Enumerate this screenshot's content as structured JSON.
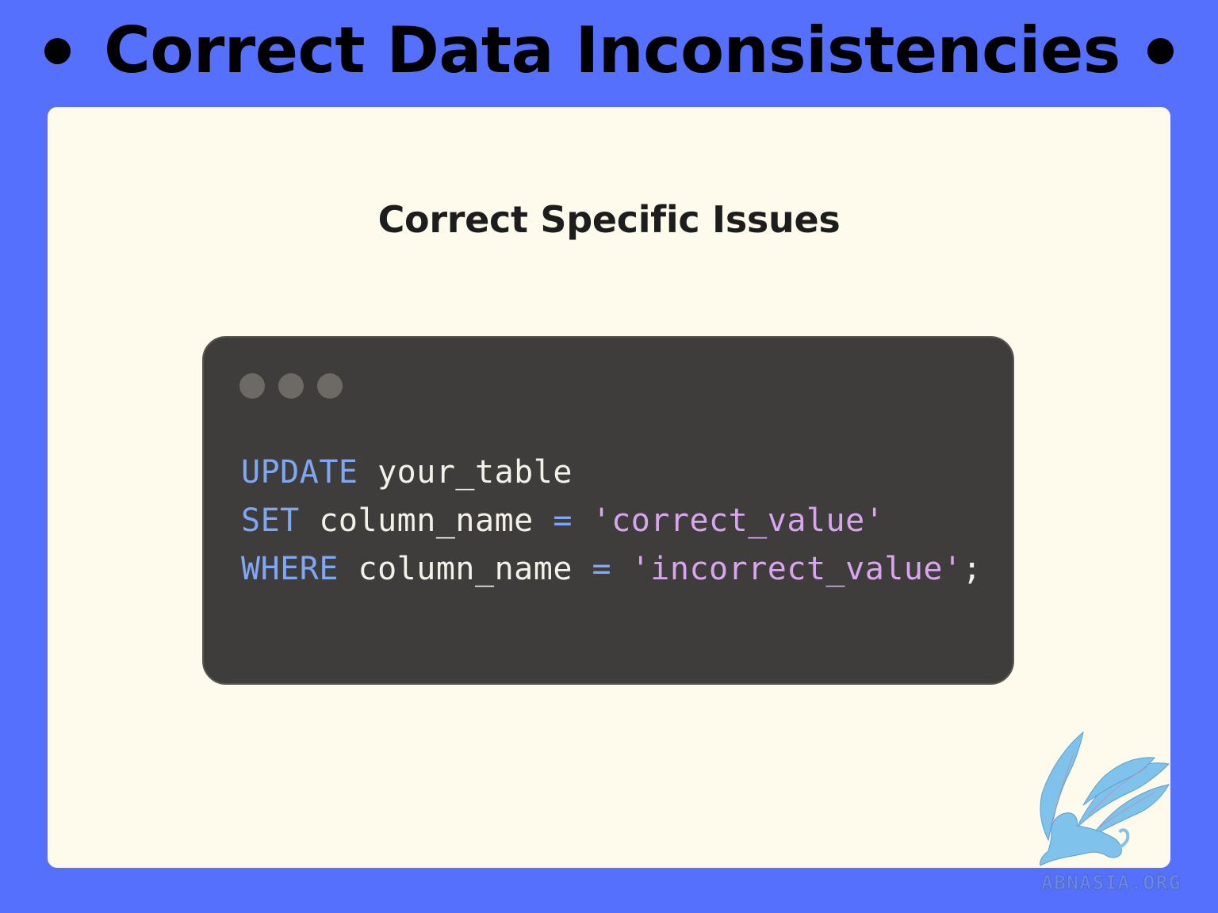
{
  "header": {
    "title": "Correct Data Inconsistencies"
  },
  "card": {
    "heading": "Correct Specific Issues"
  },
  "code_window": {
    "lines": [
      {
        "keyword": "UPDATE",
        "text": "your_table"
      },
      {
        "keyword": "SET",
        "column": "column_name",
        "operator": "=",
        "value": "'correct_value'"
      },
      {
        "keyword": "WHERE",
        "column": "column_name",
        "operator": "=",
        "value": "'incorrect_value'",
        "terminator": ";"
      }
    ]
  },
  "watermark": {
    "text": "ABNASIA.ORG",
    "icon": "griffin-logo-icon"
  },
  "colors": {
    "background": "#5570fd",
    "card": "#fefaec",
    "code_background": "#3f3d3b",
    "keyword": "#7fa8f4",
    "string": "#d8a6ee",
    "code_text": "#f4f1e9"
  }
}
